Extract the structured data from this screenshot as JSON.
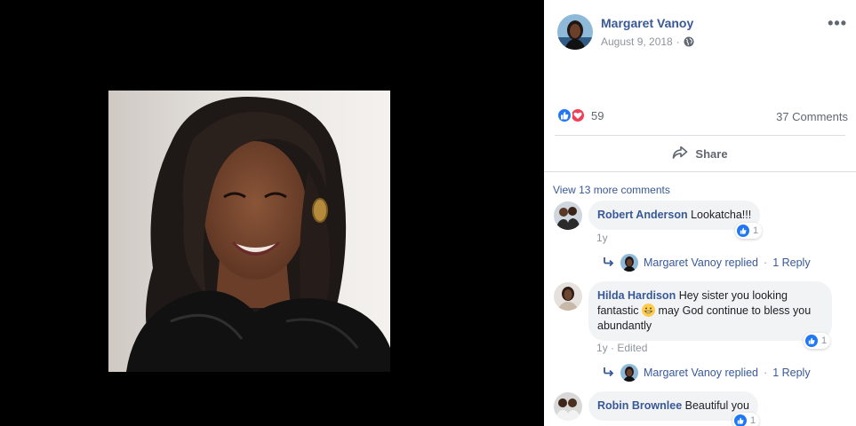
{
  "post": {
    "author": "Margaret Vanoy",
    "date": "August 9, 2018",
    "separator": "·",
    "reaction_count": "59",
    "comments_count": "37 Comments",
    "share_label": "Share",
    "view_more": "View 13 more comments"
  },
  "comments": [
    {
      "name": "Robert Anderson",
      "text": "Lookatcha!!!",
      "time": "1y",
      "likes": "1",
      "reply_author": "Margaret Vanoy replied",
      "reply_count": "1 Reply"
    },
    {
      "name": "Hilda Hardison",
      "text_line1": "Hey sister you looking",
      "text_line2a": "fantastic",
      "text_line2b": "may God continue to bless you",
      "text_line3": "abundantly",
      "time": "1y",
      "edited": "Edited",
      "likes": "1",
      "reply_author": "Margaret Vanoy replied",
      "reply_count": "1 Reply"
    },
    {
      "name": "Robin Brownlee",
      "text": "Beautiful you",
      "likes": "1"
    }
  ],
  "icons": {
    "more": "more-options-icon",
    "globe": "globe-icon",
    "like": "like-icon",
    "love": "love-icon",
    "share": "share-icon",
    "reply": "reply-arrow-icon"
  },
  "colors": {
    "link": "#385898",
    "like_blue": "#2078f4",
    "love_red": "#f33e58",
    "bubble_bg": "#f2f3f5"
  }
}
